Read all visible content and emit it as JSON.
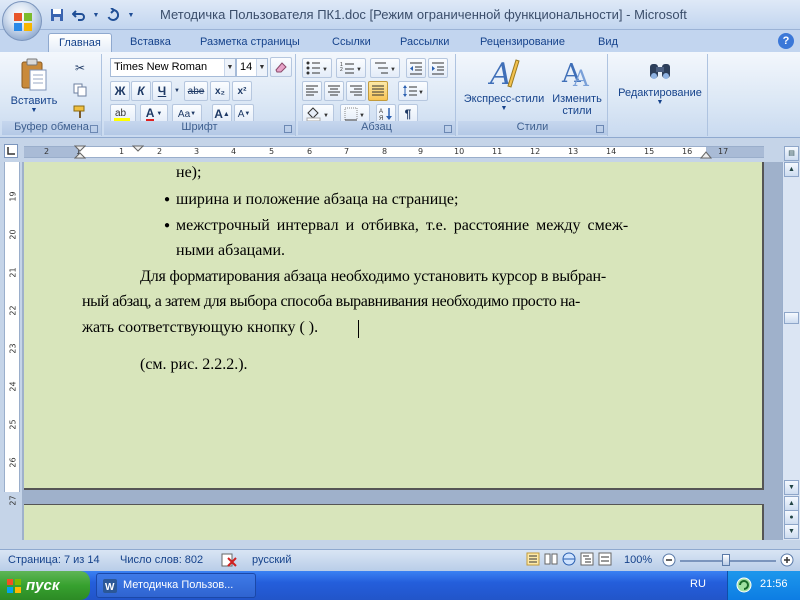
{
  "window": {
    "title": "Методичка Пользователя ПК1.doc [Режим ограниченной функциональности] - Microsoft"
  },
  "tabs": [
    "Главная",
    "Вставка",
    "Разметка страницы",
    "Ссылки",
    "Рассылки",
    "Рецензирование",
    "Вид"
  ],
  "ribbon": {
    "clipboard": {
      "label": "Буфер обмена",
      "paste": "Вставить"
    },
    "font": {
      "label": "Шрифт",
      "font_name": "Times New Roman",
      "font_size": "14",
      "bold": "Ж",
      "italic": "К",
      "underline": "Ч",
      "strike": "abe",
      "subscript": "x₂",
      "superscript": "x²",
      "grow": "A",
      "shrink": "A",
      "change_case": "Aa",
      "color_letter": "A"
    },
    "paragraph": {
      "label": "Абзац",
      "pilcrow": "¶"
    },
    "styles": {
      "label": "Стили",
      "express": "Экспресс-стили",
      "change": "Изменить стили"
    },
    "editing": {
      "label": "Редактирование"
    }
  },
  "ruler_labels": [
    "2",
    "1",
    "1",
    "2",
    "3",
    "4",
    "5",
    "6",
    "7",
    "8",
    "9",
    "10",
    "11",
    "12",
    "13",
    "14",
    "15",
    "16",
    "17"
  ],
  "vruler_labels": [
    "19",
    "20",
    "21",
    "22",
    "23",
    "24",
    "25",
    "26",
    "27"
  ],
  "document": {
    "lines": [
      "не);",
      "ширина и положение абзаца на странице;",
      "межстрочный интервал и отбивка, т.е. расстояние между смеж-",
      "ными абзацами.",
      "Для форматирования абзаца необходимо установить курсор в выбран-",
      "ный абзац, а затем для выбора способа выравнивания необходимо просто на-",
      "жать соответствующую кнопку ( ).",
      "(см. рис. 2.2.2.)."
    ]
  },
  "status": {
    "page": "Страница: 7 из 14",
    "words": "Число слов: 802",
    "language": "русский",
    "zoom": "100%"
  },
  "taskbar": {
    "start": "пуск",
    "task": "Методичка Пользов...",
    "lang": "RU",
    "time": "21:56"
  }
}
